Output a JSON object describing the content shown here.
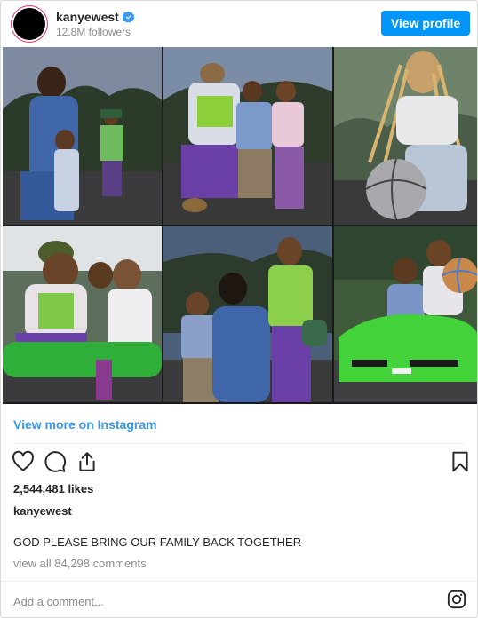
{
  "header": {
    "username": "kanyewest",
    "followers": "12.8M followers",
    "verified_icon": "verified-badge-icon",
    "view_profile_label": "View profile"
  },
  "photos": [
    {
      "name": "photo-mother-with-children-denim"
    },
    {
      "name": "photo-three-children-sitting"
    },
    {
      "name": "photo-child-with-basketball"
    },
    {
      "name": "photo-children-on-green-bike"
    },
    {
      "name": "photo-mother-kissing-child"
    },
    {
      "name": "photo-children-in-green-car"
    }
  ],
  "view_more_label": "View more on Instagram",
  "actions": {
    "like_icon": "heart-icon",
    "comment_icon": "comment-icon",
    "share_icon": "share-icon",
    "save_icon": "bookmark-icon"
  },
  "likes": "2,544,481 likes",
  "caption_username": "kanyewest",
  "caption": "GOD PLEASE BRING OUR FAMILY BACK TOGETHER",
  "view_comments": "view all 84,298 comments",
  "comment_placeholder": "Add a comment...",
  "colors": {
    "accent": "#0095f6",
    "link": "#3897f0",
    "muted": "#8e8e8e",
    "text": "#262626"
  }
}
